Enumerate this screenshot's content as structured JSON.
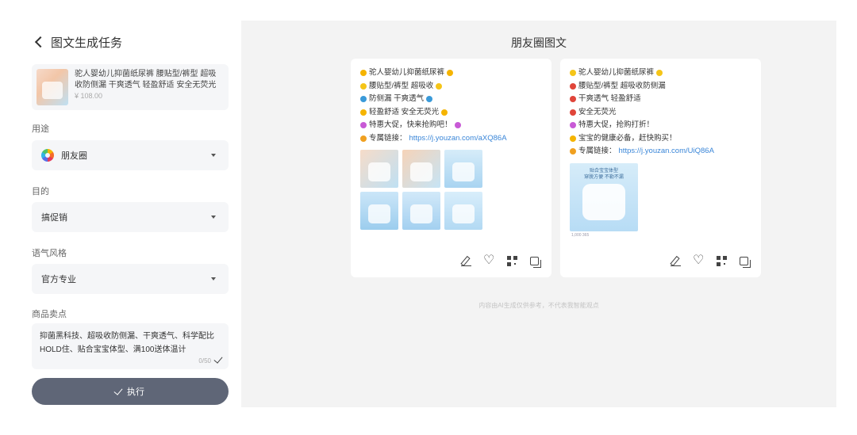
{
  "header": {
    "title": "图文生成任务"
  },
  "product": {
    "name": "驼人婴幼儿抑菌纸尿裤 腰贴型/裤型 超吸收防侧漏 干爽透气 轻盈舒适 安全无荧光",
    "price": "¥ 108.00"
  },
  "form": {
    "usage_label": "用途",
    "usage_value": "朋友圈",
    "purpose_label": "目的",
    "purpose_value": "搞促销",
    "tone_label": "语气风格",
    "tone_value": "官方专业",
    "selling_label": "商品卖点",
    "selling_value": "抑菌黑科技、超吸收防侧漏、干爽透气、科学配比HOLD住、贴合宝宝体型、满100送体温计",
    "counter": "0/50",
    "execute_label": "执行"
  },
  "main": {
    "title": "朋友圈图文",
    "disclaimer": "内容由AI生成仅供参考，不代表我智能观点"
  },
  "card1": {
    "lines": [
      "驼人婴幼儿抑菌纸尿裤",
      "腰贴型/裤型 超吸收",
      "防侧漏 干爽透气",
      "轻盈舒适 安全无荧光",
      "特惠大促，快来抢购吧！",
      "专属链接："
    ],
    "link": "https://j.youzan.com/aXQ86A",
    "emoji_colors": [
      "#f5b400",
      "#f5c518",
      "#3a9ad9",
      "#f5b400",
      "#c85ad6",
      "#f0a020"
    ]
  },
  "card2": {
    "lines": [
      "驼人婴幼儿抑菌纸尿裤",
      "腰贴型/裤型 超吸收防侧漏",
      "干爽透气 轻盈舒适",
      "安全无荧光",
      "特惠大促，抢购打折！",
      "宝宝的健康必备，赶快购买！",
      "专属链接："
    ],
    "link": "https://j.youzan.com/UiQ86A",
    "image_title": "贴合宝宝体型\n穿脱方便 不勒不漏",
    "image_caption": "1,000 365",
    "emoji_colors": [
      "#f5c518",
      "#e0453a",
      "#e0453a",
      "#e0453a",
      "#c85ad6",
      "#f5b400",
      "#f0a020"
    ]
  },
  "colors": {
    "accent": "#5f6677",
    "link": "#3a86d8",
    "panel": "#f3f3f3"
  }
}
